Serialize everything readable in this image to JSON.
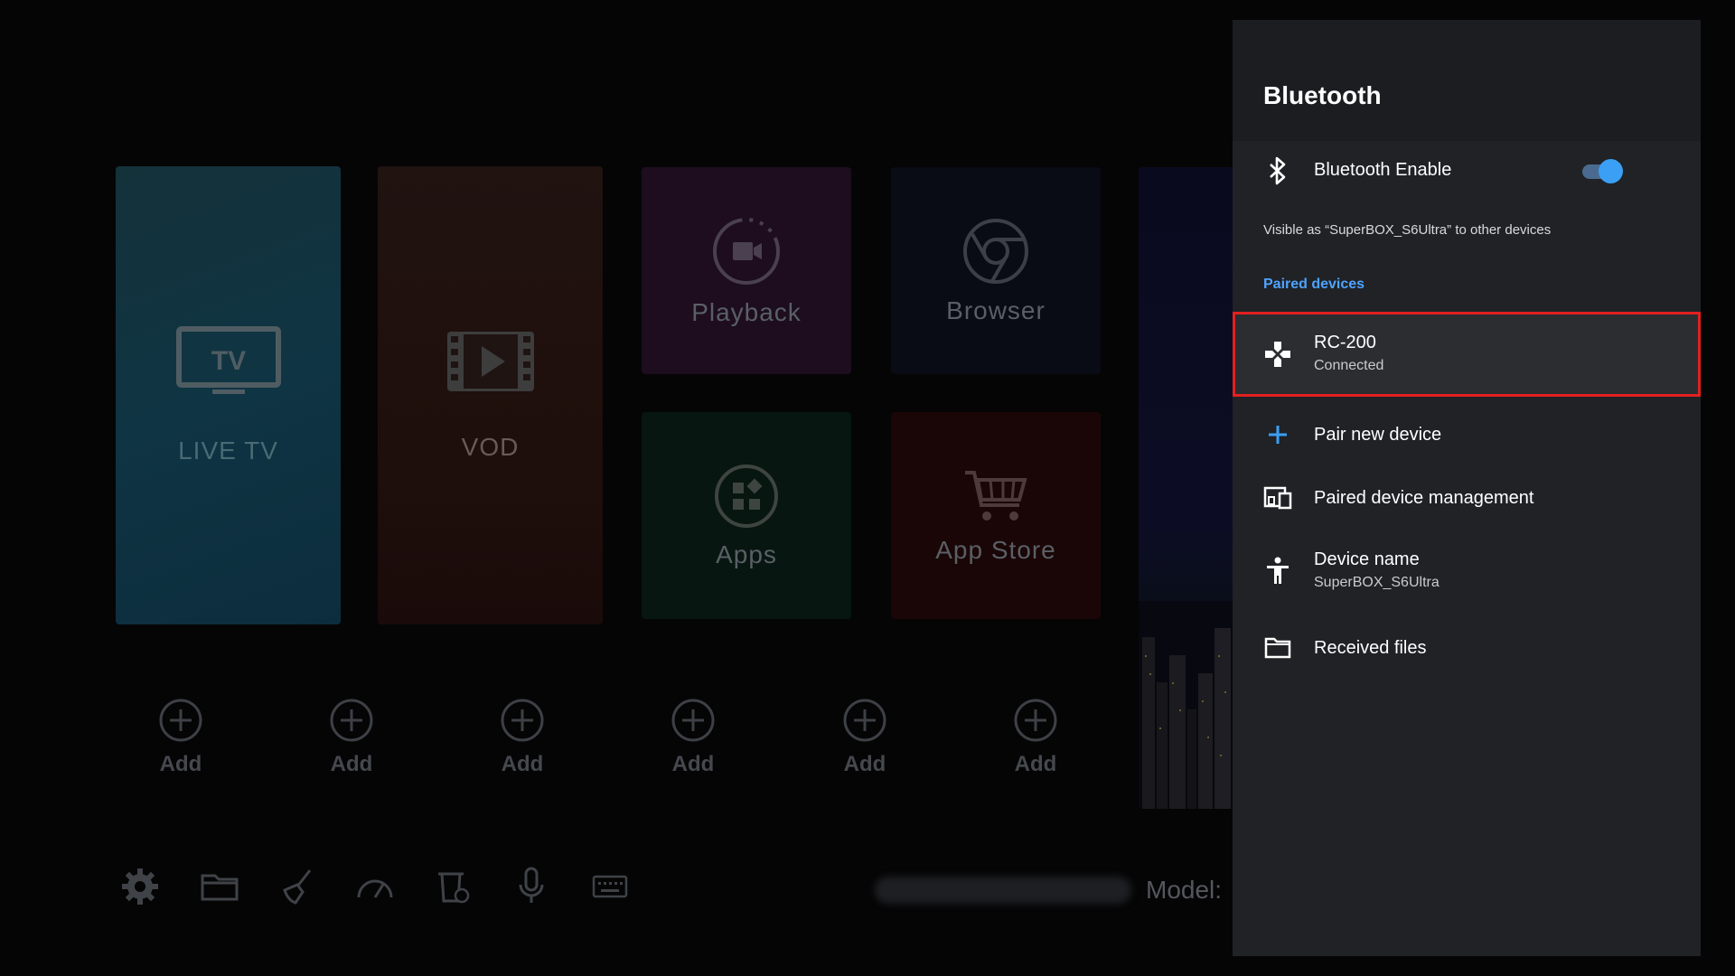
{
  "launcher": {
    "tiles": {
      "live_tv": "LIVE TV",
      "vod": "VOD",
      "playback": "Playback",
      "browser": "Browser",
      "apps": "Apps",
      "app_store": "App Store"
    },
    "add_slots": [
      "Add",
      "Add",
      "Add",
      "Add",
      "Add",
      "Add"
    ],
    "bottom_icons": [
      "gear-icon",
      "folder-icon",
      "broom-icon",
      "speedometer-icon",
      "trash-clock-icon",
      "microphone-icon",
      "keyboard-icon"
    ],
    "model_label": "Model:"
  },
  "bluetooth": {
    "title": "Bluetooth",
    "enable": {
      "label": "Bluetooth Enable",
      "on": true,
      "icon": "bluetooth-icon"
    },
    "visible_note": "Visible as “SuperBOX_S6Ultra” to other devices",
    "paired_header": "Paired devices",
    "paired": [
      {
        "name": "RC-200",
        "status": "Connected",
        "icon": "gamepad-icon"
      }
    ],
    "items": {
      "pair_new": "Pair new device",
      "management": "Paired device management",
      "device_name_label": "Device name",
      "device_name_value": "SuperBOX_S6Ultra",
      "received_files": "Received files"
    },
    "colors": {
      "accent": "#3b9ff5",
      "section": "#4ea3ff",
      "selection_border": "#e3201f"
    }
  }
}
